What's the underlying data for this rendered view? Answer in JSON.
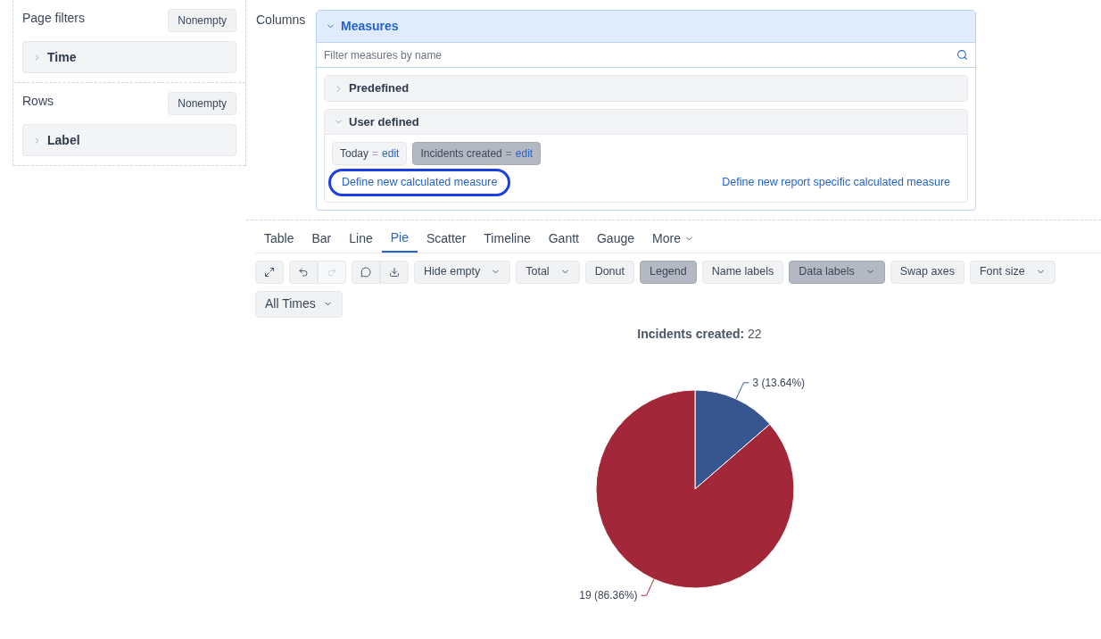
{
  "page_filters": {
    "title": "Page filters",
    "nonempty_button": "Nonempty",
    "items": [
      {
        "label": "Time",
        "expanded": false
      }
    ]
  },
  "rows": {
    "title": "Rows",
    "nonempty_button": "Nonempty",
    "items": [
      {
        "label": "Label",
        "expanded": false
      }
    ]
  },
  "columns": {
    "title": "Columns",
    "measures": {
      "title": "Measures",
      "expanded": true,
      "filter_placeholder": "Filter measures by name",
      "sections": [
        {
          "title": "Predefined",
          "expanded": false
        },
        {
          "title": "User defined",
          "expanded": true,
          "chips": [
            {
              "name": "Today",
              "separator": "=",
              "action": "edit",
              "selected": false
            },
            {
              "name": "Incidents created",
              "separator": "=",
              "action": "edit",
              "selected": true
            }
          ],
          "links": [
            {
              "label": "Define new calculated measure",
              "focused": true
            },
            {
              "label": "Define new report specific calculated measure",
              "focused": false
            }
          ]
        }
      ]
    }
  },
  "chart_tabs": [
    {
      "label": "Table",
      "selected": false,
      "kind": "tab"
    },
    {
      "label": "Bar",
      "selected": false,
      "kind": "tab"
    },
    {
      "label": "Line",
      "selected": false,
      "kind": "tab"
    },
    {
      "label": "Pie",
      "selected": true,
      "kind": "tab"
    },
    {
      "label": "Scatter",
      "selected": false,
      "kind": "tab"
    },
    {
      "label": "Timeline",
      "selected": false,
      "kind": "tab"
    },
    {
      "label": "Gantt",
      "selected": false,
      "kind": "tab"
    },
    {
      "label": "Gauge",
      "selected": false,
      "kind": "tab"
    },
    {
      "label": "More",
      "selected": false,
      "kind": "menu"
    }
  ],
  "toolbar": {
    "icon_groups": [
      [
        {
          "disabled": false
        }
      ],
      [
        {
          "disabled": false
        },
        {
          "disabled": true
        }
      ],
      [
        {
          "disabled": false
        },
        {
          "disabled": false
        }
      ]
    ],
    "buttons": [
      {
        "label": "Hide empty",
        "dropdown": true,
        "active": false
      },
      {
        "label": "Total",
        "dropdown": true,
        "active": false
      },
      {
        "label": "Donut",
        "dropdown": false,
        "active": false
      },
      {
        "label": "Legend",
        "dropdown": false,
        "active": true
      },
      {
        "label": "Name labels",
        "dropdown": false,
        "active": false
      },
      {
        "label": "Data labels",
        "dropdown": true,
        "active": true
      },
      {
        "label": "Swap axes",
        "dropdown": false,
        "active": false
      },
      {
        "label": "Font size",
        "dropdown": true,
        "active": false
      }
    ]
  },
  "time_filter": {
    "label": "All Times"
  },
  "chart": {
    "title": "**Incidents created:** 22",
    "chart_data": {
      "type": "pie",
      "values": [
        3,
        19
      ],
      "colors": [
        "#37558f",
        "#a22739"
      ],
      "data_labels": true,
      "value_labels": [
        "3 (13.64%)",
        "19 (86.36%)"
      ]
    }
  }
}
